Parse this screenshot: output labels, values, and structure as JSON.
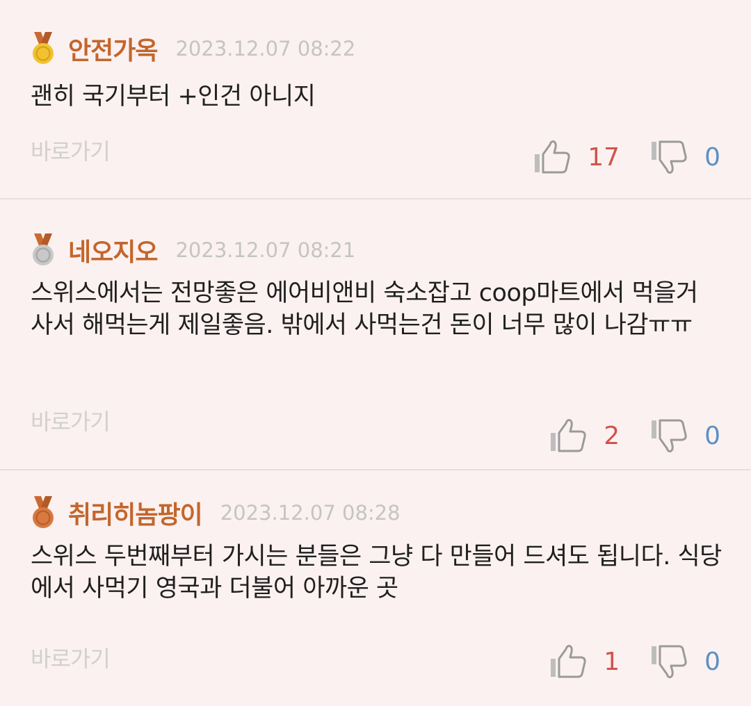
{
  "comments": [
    {
      "author": "안전가옥",
      "medal": "gold",
      "date": "2023.12.07 08:22",
      "text": "괜히 국기부터 +인건 아니지",
      "goto_label": "바로가기",
      "likes": "17",
      "dislikes": "0"
    },
    {
      "author": "네오지오",
      "medal": "silver",
      "date": "2023.12.07 08:21",
      "text": "스위스에서는 전망좋은 에어비앤비 숙소잡고 coop마트에서 먹을거 사서 해먹는게 제일좋음. 밖에서 사먹는건 돈이 너무 많이 나감ㅠㅠ",
      "goto_label": "바로가기",
      "likes": "2",
      "dislikes": "0"
    },
    {
      "author": "취리히놈팡이",
      "medal": "bronze",
      "date": "2023.12.07 08:28",
      "text": "스위스 두번째부터 가시는 분들은 그냥 다 만들어 드셔도 됩니다. 식당에서 사먹기 영국과 더불어 아까운 곳",
      "goto_label": "바로가기",
      "likes": "1",
      "dislikes": "0"
    }
  ],
  "colors": {
    "background": "#fbf1f0",
    "author": "#c3662c",
    "likes": "#d0544c",
    "dislikes": "#5b90c6",
    "gold": "#f2c230",
    "silver": "#c8c8c8",
    "bronze": "#d9793f",
    "ribbon": "#c96a33"
  },
  "icons": {
    "medal": "medal-icon",
    "like": "thumbs-up-icon",
    "dislike": "thumbs-down-icon"
  }
}
